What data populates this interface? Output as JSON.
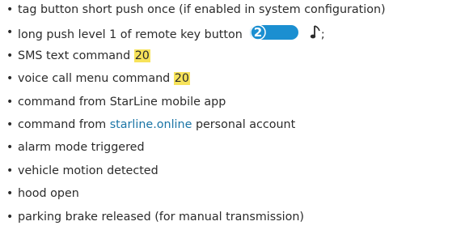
{
  "items": [
    {
      "text": "tag button short push once (if enabled in system configuration)"
    },
    {
      "before": "long push level 1 of remote key button",
      "key_number": "2",
      "after": ";"
    },
    {
      "before": "SMS text command",
      "code": "20"
    },
    {
      "before": "voice call menu command",
      "code": "20"
    },
    {
      "text": "command from StarLine mobile app"
    },
    {
      "before": "command from",
      "link": "starline.online",
      "after": "personal account"
    },
    {
      "text": "alarm mode triggered"
    },
    {
      "text": "vehicle motion detected"
    },
    {
      "text": "hood open"
    },
    {
      "text": "parking brake released (for manual transmission)"
    }
  ],
  "bullet": "•",
  "colors": {
    "text": "#2b2b2b",
    "highlight": "#f7e35a",
    "link": "#1b75a6",
    "key_button": "#1b8fd1"
  },
  "icons": {
    "key_button": "remote-key-button-icon",
    "note": "music-note-icon"
  }
}
